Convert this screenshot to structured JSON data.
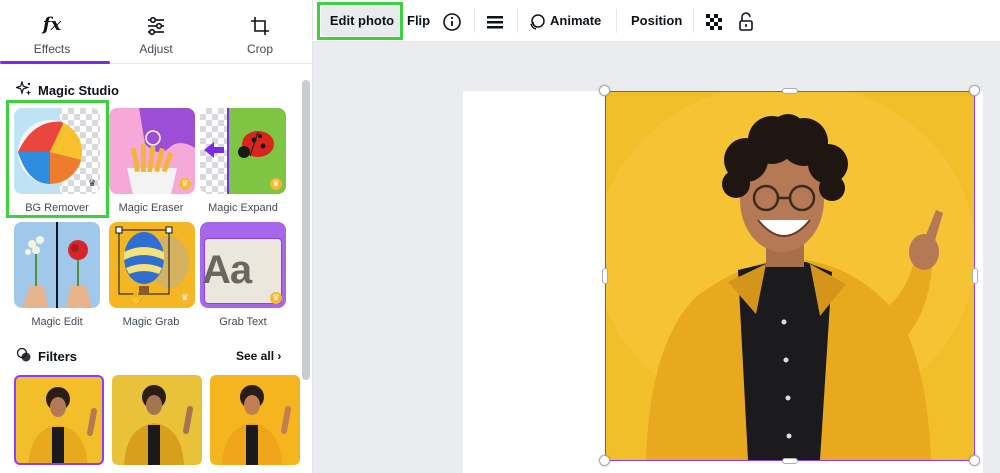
{
  "panel": {
    "tabs": [
      {
        "label": "Effects",
        "icon": "fx-icon"
      },
      {
        "label": "Adjust",
        "icon": "sliders-icon"
      },
      {
        "label": "Crop",
        "icon": "crop-icon"
      }
    ],
    "active_tab": "Effects"
  },
  "magic_studio": {
    "title": "Magic Studio",
    "tools": [
      {
        "label": "BG Remover"
      },
      {
        "label": "Magic Eraser"
      },
      {
        "label": "Magic Expand"
      },
      {
        "label": "Magic Edit"
      },
      {
        "label": "Magic Grab"
      },
      {
        "label": "Grab Text"
      }
    ],
    "grab_text_sample": "Aa"
  },
  "filters": {
    "title": "Filters",
    "see_all": "See all"
  },
  "toolbar": {
    "edit_photo": "Edit photo",
    "flip": "Flip",
    "animate": "Animate",
    "position": "Position"
  },
  "colors": {
    "accent": "#7d2ae8",
    "selection": "#8b3dff",
    "highlight": "#3bd23d",
    "photo_bg": "#f2bf2b",
    "jacket": "#e9a91e"
  }
}
